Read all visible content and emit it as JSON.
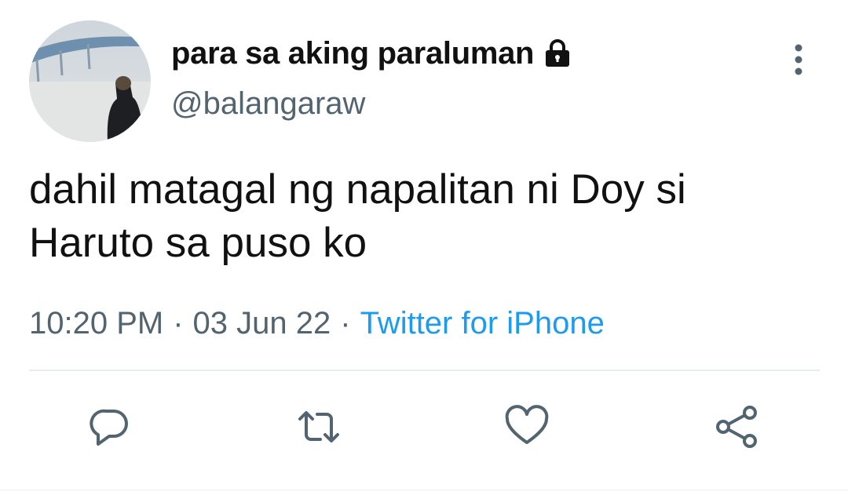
{
  "tweet": {
    "display_name": "para sa aking paraluman",
    "handle": "@balangaraw",
    "protected_icon": "lock-icon",
    "text": "dahil matagal ng napalitan ni Doy si Haruto sa puso ko",
    "time": "10:20 PM",
    "separator": "·",
    "date": "03 Jun 22",
    "source": "Twitter for iPhone"
  },
  "actions": {
    "reply_icon": "reply-icon",
    "retweet_icon": "retweet-icon",
    "like_icon": "heart-icon",
    "share_icon": "share-icon"
  },
  "menu_icon": "more-vertical-icon",
  "colors": {
    "text_primary": "#111111",
    "text_secondary": "#536471",
    "link": "#1d9bf0",
    "icon": "#536471",
    "divider": "#e6ecf0"
  }
}
